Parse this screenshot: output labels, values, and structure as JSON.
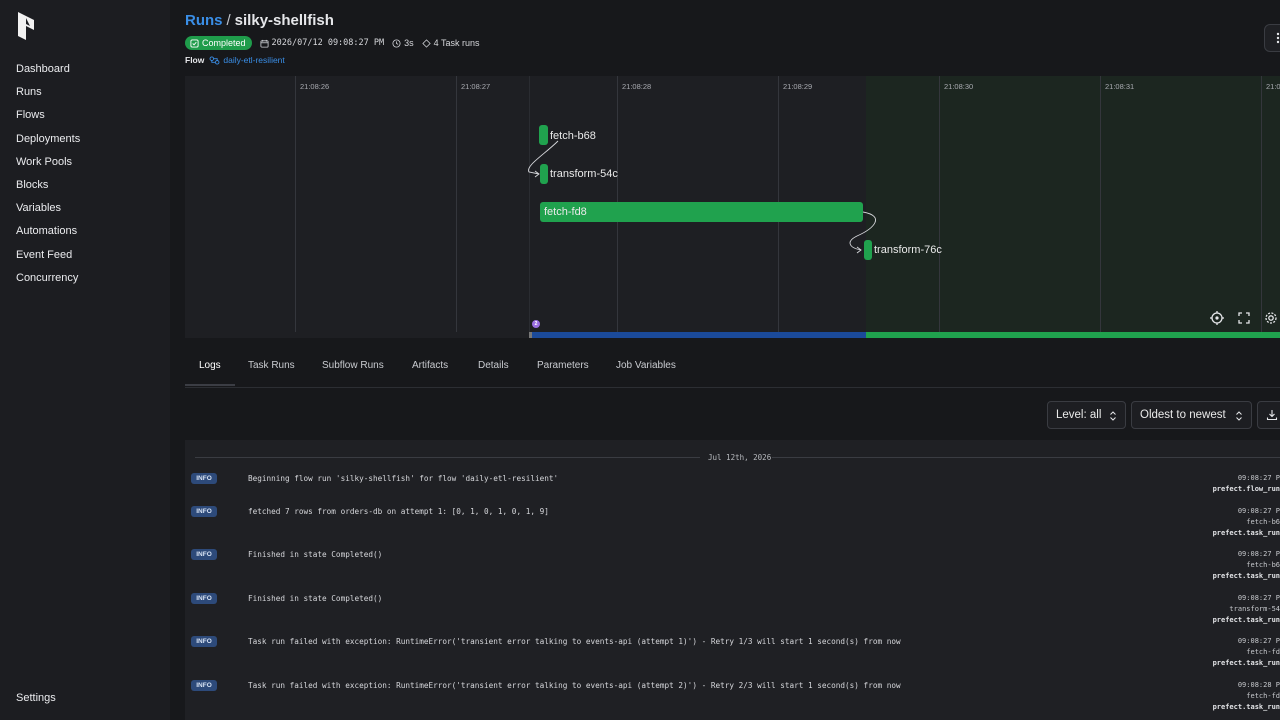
{
  "sidebar": {
    "items": [
      {
        "label": "Dashboard"
      },
      {
        "label": "Runs"
      },
      {
        "label": "Flows"
      },
      {
        "label": "Deployments"
      },
      {
        "label": "Work Pools"
      },
      {
        "label": "Blocks"
      },
      {
        "label": "Variables"
      },
      {
        "label": "Automations"
      },
      {
        "label": "Event Feed"
      },
      {
        "label": "Concurrency"
      }
    ],
    "settings_label": "Settings"
  },
  "header": {
    "breadcrumb_root": "Runs",
    "breadcrumb_sep": "/",
    "run_name": "silky-shellfish",
    "status": "Completed",
    "datetime": "2026/07/12 09:08:27 PM",
    "duration": "3s",
    "task_runs": "4 Task runs",
    "flow_label": "Flow",
    "flow_name": "daily-etl-resilient"
  },
  "graph": {
    "ticks": [
      "21:08:26",
      "21:08:27",
      "21:08:28",
      "21:08:29",
      "21:08:30",
      "21:08:31",
      "21:08"
    ],
    "nodes": [
      {
        "label": "fetch-b68"
      },
      {
        "label": "transform-54c"
      },
      {
        "label": "fetch-fd8"
      },
      {
        "label": "transform-76c"
      }
    ],
    "marker_count": "2"
  },
  "tabs": [
    {
      "label": "Logs"
    },
    {
      "label": "Task Runs"
    },
    {
      "label": "Subflow Runs"
    },
    {
      "label": "Artifacts"
    },
    {
      "label": "Details"
    },
    {
      "label": "Parameters"
    },
    {
      "label": "Job Variables"
    }
  ],
  "controls": {
    "level": "Level: all",
    "order": "Oldest to newest"
  },
  "logs": {
    "date": "Jul 12th, 2026",
    "rows": [
      {
        "level": "INFO",
        "message": "Beginning flow run 'silky-shellfish' for flow 'daily-etl-resilient'",
        "time": "09:08:27 P",
        "task": "",
        "logger": "prefect.flow_run"
      },
      {
        "level": "INFO",
        "message": "fetched 7 rows from orders-db on attempt 1: [0, 1, 0, 1, 0, 1, 9]",
        "time": "09:08:27 P",
        "task": "fetch-b6",
        "logger": "prefect.task_run"
      },
      {
        "level": "INFO",
        "message": "Finished in state Completed()",
        "time": "09:08:27 P",
        "task": "fetch-b6",
        "logger": "prefect.task_run"
      },
      {
        "level": "INFO",
        "message": "Finished in state Completed()",
        "time": "09:08:27 P",
        "task": "transform-54",
        "logger": "prefect.task_run"
      },
      {
        "level": "INFO",
        "message": "Task run failed with exception: RuntimeError('transient error talking to events-api (attempt 1)') - Retry 1/3 will start 1 second(s) from now",
        "time": "09:08:27 P",
        "task": "fetch-fd",
        "logger": "prefect.task_run"
      },
      {
        "level": "INFO",
        "message": "Task run failed with exception: RuntimeError('transient error talking to events-api (attempt 2)') - Retry 2/3 will start 1 second(s) from now",
        "time": "09:08:28 P",
        "task": "fetch-fd",
        "logger": "prefect.task_run"
      }
    ]
  },
  "colors": {
    "accent": "#3a8ee6",
    "success": "#20a24e",
    "running": "#1b4a9a",
    "bg": "#17181b"
  }
}
